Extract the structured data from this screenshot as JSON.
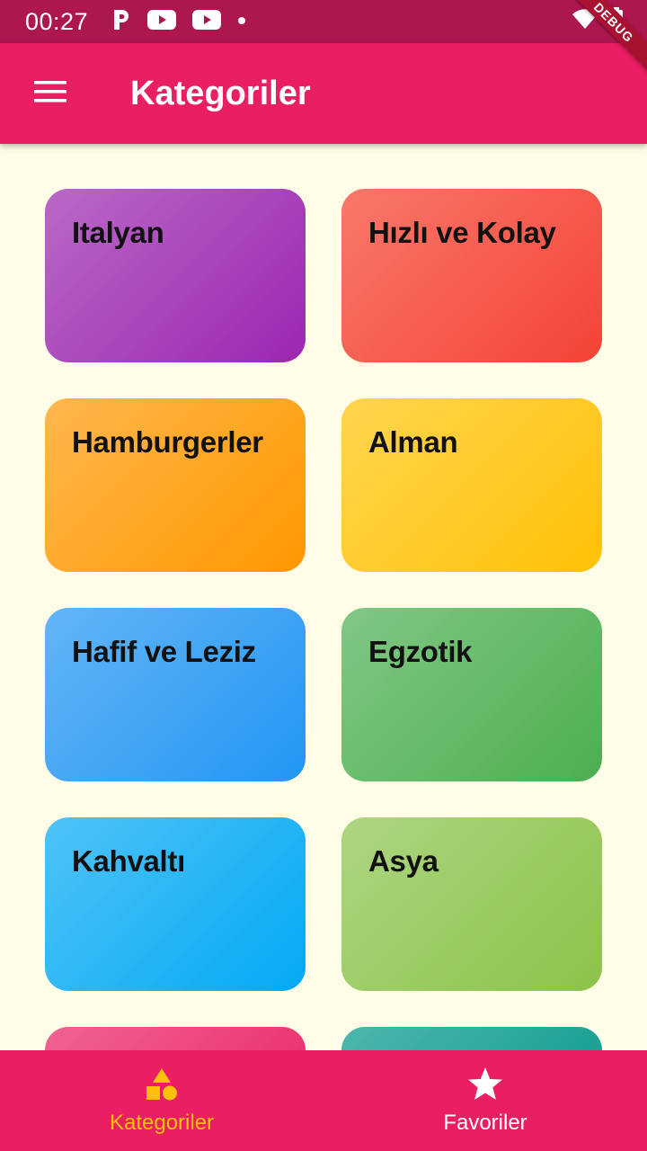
{
  "status_bar": {
    "time": "00:27",
    "icons": [
      "p-icon",
      "youtube-icon",
      "youtube-icon",
      "dot-icon",
      "wifi-icon",
      "battery-icon"
    ],
    "debug_label": "DEBUG"
  },
  "app_bar": {
    "title": "Kategoriler",
    "menu_icon": "menu-icon"
  },
  "categories": [
    {
      "label": "Italyan",
      "colors": [
        "#BA68C8",
        "#9C27B0"
      ]
    },
    {
      "label": "Hızlı ve Kolay",
      "colors": [
        "#F8786B",
        "#F44336"
      ]
    },
    {
      "label": "Hamburgerler",
      "colors": [
        "#FFB74D",
        "#FF9800"
      ]
    },
    {
      "label": "Alman",
      "colors": [
        "#FFD54F",
        "#FFC107"
      ]
    },
    {
      "label": "Hafif ve Leziz",
      "colors": [
        "#64B5F6",
        "#2196F3"
      ]
    },
    {
      "label": "Egzotik",
      "colors": [
        "#81C784",
        "#4CAF50"
      ]
    },
    {
      "label": "Kahvaltı",
      "colors": [
        "#4FC3F7",
        "#03A9F4"
      ]
    },
    {
      "label": "Asya",
      "colors": [
        "#AED581",
        "#8BC34A"
      ]
    },
    {
      "label": "",
      "colors": [
        "#F06292",
        "#E91E63"
      ]
    },
    {
      "label": "",
      "colors": [
        "#4DB6AC",
        "#009688"
      ]
    }
  ],
  "bottom_nav": {
    "items": [
      {
        "label": "Kategoriler",
        "icon": "category-shapes-icon",
        "active": true
      },
      {
        "label": "Favoriler",
        "icon": "star-icon",
        "active": false
      }
    ],
    "active_color": "#FFC107",
    "inactive_color": "#FFFFFF"
  },
  "colors": {
    "primary": "#E91E63",
    "status_bar": "#AD1750",
    "background": "#FFFDE7"
  }
}
